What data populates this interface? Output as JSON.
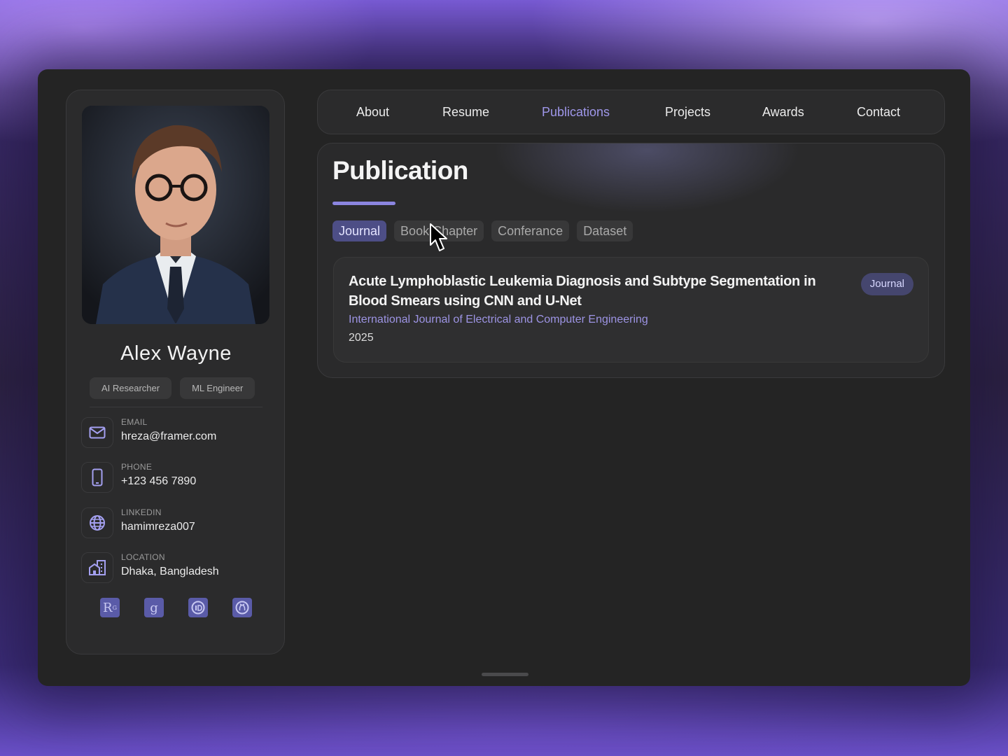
{
  "profile": {
    "name": "Alex Wayne",
    "roles": [
      "AI Researcher",
      "ML Engineer"
    ],
    "contacts": [
      {
        "label": "EMAIL",
        "value": "hreza@framer.com",
        "icon": "mail-icon"
      },
      {
        "label": "PHONE",
        "value": "+123 456 7890",
        "icon": "phone-icon"
      },
      {
        "label": "LINKEDIN",
        "value": "hamimreza007",
        "icon": "globe-icon"
      },
      {
        "label": "LOCATION",
        "value": "Dhaka, Bangladesh",
        "icon": "building-icon"
      }
    ],
    "socials": [
      "researchgate-icon",
      "google-scholar-icon",
      "orcid-icon",
      "github-icon"
    ]
  },
  "nav": {
    "items": [
      "About",
      "Resume",
      "Publications",
      "Projects",
      "Awards",
      "Contact"
    ],
    "active": "Publications"
  },
  "publication": {
    "title": "Publication",
    "filters": [
      "Journal",
      "Book Chapter",
      "Conferance",
      "Dataset"
    ],
    "active_filter": "Journal",
    "items": [
      {
        "title": "Acute Lymphoblastic Leukemia Diagnosis and Subtype Segmentation in Blood Smears using CNN and U-Net",
        "venue": "International Journal of Electrical and Computer Engineering",
        "year": "2025",
        "type": "Journal"
      }
    ]
  },
  "colors": {
    "accent": "#9f97ea",
    "chip_active": "#4d4e86",
    "panel": "#2b2b2c"
  }
}
